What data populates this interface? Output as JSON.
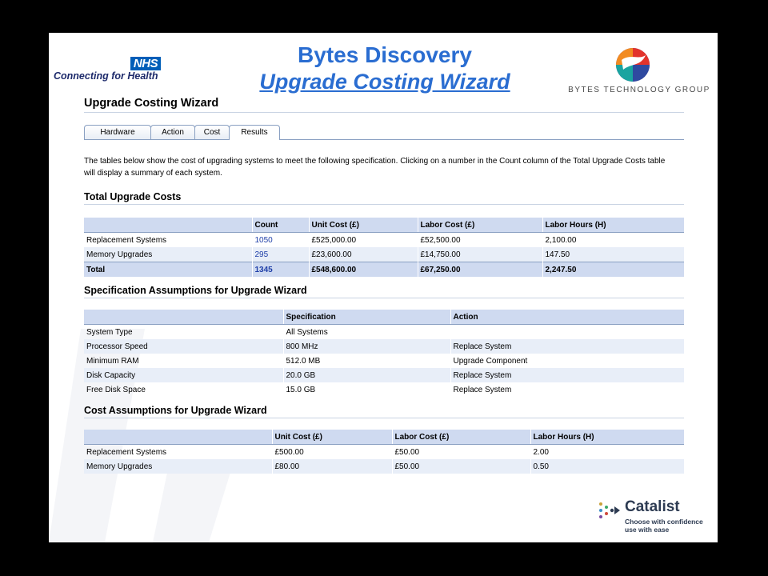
{
  "header": {
    "nhs_badge": "NHS",
    "nhs_tagline": "Connecting for Health",
    "title": "Bytes Discovery",
    "subtitle": "Upgrade Costing Wizard",
    "bytes_brand": "BYTES TECHNOLOGY GROUP"
  },
  "page": {
    "heading": "Upgrade Costing Wizard",
    "tabs": [
      {
        "label": "Hardware"
      },
      {
        "label": "Action"
      },
      {
        "label": "Cost"
      },
      {
        "label": "Results",
        "active": true
      }
    ],
    "intro": "The tables below show the cost of upgrading systems to meet the following specification. Clicking on a number in the Count column of the Total Upgrade Costs table will display a summary of each system."
  },
  "total_costs": {
    "heading": "Total Upgrade Costs",
    "columns": [
      "",
      "Count",
      "Unit Cost (£)",
      "Labor Cost (£)",
      "Labor Hours (H)"
    ],
    "rows": [
      {
        "label": "Replacement Systems",
        "count": "1050",
        "unit_cost": "£525,000.00",
        "labor_cost": "£52,500.00",
        "labor_hours": "2,100.00"
      },
      {
        "label": "Memory Upgrades",
        "count": "295",
        "unit_cost": "£23,600.00",
        "labor_cost": "£14,750.00",
        "labor_hours": "147.50"
      }
    ],
    "total": {
      "label": "Total",
      "count": "1345",
      "unit_cost": "£548,600.00",
      "labor_cost": "£67,250.00",
      "labor_hours": "2,247.50"
    }
  },
  "spec_assumptions": {
    "heading": "Specification Assumptions for Upgrade Wizard",
    "columns": [
      "",
      "Specification",
      "Action"
    ],
    "rows": [
      {
        "label": "System Type",
        "spec": "All Systems",
        "action": ""
      },
      {
        "label": "Processor Speed",
        "spec": "800 MHz",
        "action": "Replace System"
      },
      {
        "label": "Minimum RAM",
        "spec": "512.0 MB",
        "action": "Upgrade Component"
      },
      {
        "label": "Disk Capacity",
        "spec": "20.0 GB",
        "action": "Replace System"
      },
      {
        "label": "Free Disk Space",
        "spec": "15.0 GB",
        "action": "Replace System"
      }
    ]
  },
  "cost_assumptions": {
    "heading": "Cost Assumptions for Upgrade Wizard",
    "columns": [
      "",
      "Unit Cost (£)",
      "Labor Cost (£)",
      "Labor Hours (H)"
    ],
    "rows": [
      {
        "label": "Replacement Systems",
        "unit_cost": "£500.00",
        "labor_cost": "£50.00",
        "labor_hours": "2.00"
      },
      {
        "label": "Memory Upgrades",
        "unit_cost": "£80.00",
        "labor_cost": "£50.00",
        "labor_hours": "0.50"
      }
    ]
  },
  "footer": {
    "catalist_name": "Catalist",
    "catalist_tagline_1": "Choose with confidence",
    "catalist_tagline_2": "use with ease"
  },
  "colors": {
    "title_blue": "#2a6dd1",
    "nhs_blue": "#005eb8",
    "table_header": "#cfdaf0",
    "row_alt": "#e8eef8"
  }
}
